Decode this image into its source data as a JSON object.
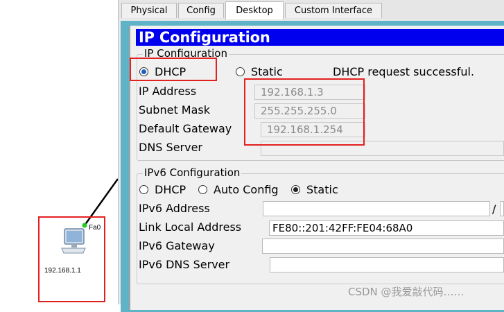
{
  "topology": {
    "port_label": "Fa0",
    "pc_ip_label": "192.168.1.1"
  },
  "tabs": [
    "Physical",
    "Config",
    "Desktop",
    "Custom Interface"
  ],
  "active_tab": "Desktop",
  "ip_config": {
    "title": "IP Configuration",
    "ipv4_group_label": "IP Configuration",
    "dhcp_label": "DHCP",
    "static_label": "Static",
    "mode": "DHCP",
    "status": "DHCP request successful.",
    "ip_address_label": "IP Address",
    "ip_address": "192.168.1.3",
    "subnet_mask_label": "Subnet Mask",
    "subnet_mask": "255.255.255.0",
    "default_gateway_label": "Default Gateway",
    "default_gateway": "192.168.1.254",
    "dns_server_label": "DNS Server",
    "dns_server": ""
  },
  "ipv6_config": {
    "group_label": "IPv6 Configuration",
    "dhcp_label": "DHCP",
    "auto_config_label": "Auto Config",
    "static_label": "Static",
    "mode": "Static",
    "ipv6_address_label": "IPv6 Address",
    "ipv6_address": "",
    "prefix_separator": "/",
    "prefix_length": "",
    "link_local_label": "Link Local Address",
    "link_local_address": "FE80::201:42FF:FE04:68A0",
    "ipv6_gateway_label": "IPv6 Gateway",
    "ipv6_gateway": "",
    "ipv6_dns_label": "IPv6 DNS Server",
    "ipv6_dns": ""
  },
  "watermark": "CSDN @我爱敲代码……",
  "colors": {
    "title_bar": "#0000ee",
    "highlight": "#e2201f",
    "frame_teal": "#5fb3c6",
    "link_indicator": "#22cc22"
  }
}
